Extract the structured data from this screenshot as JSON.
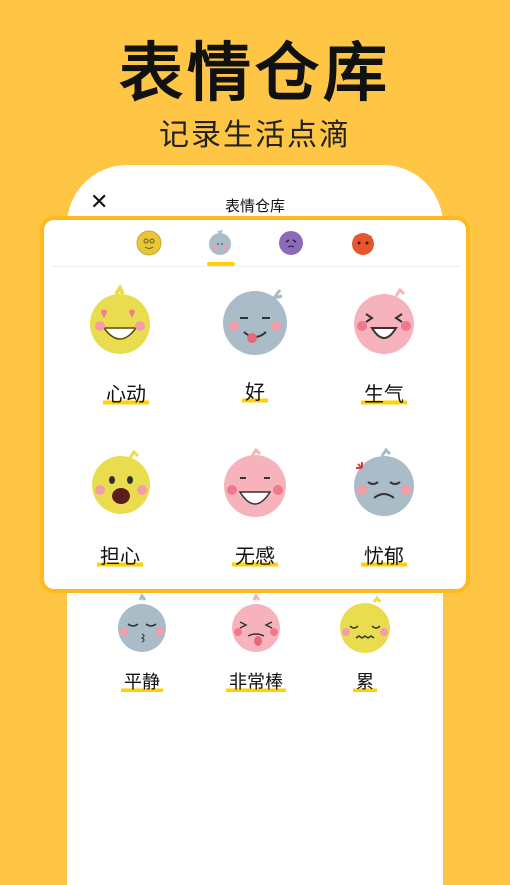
{
  "promo": {
    "title": "表情仓库",
    "subtitle": "记录生活点滴"
  },
  "dialog": {
    "title": "表情仓库",
    "close_label": "✕"
  },
  "tabs": [
    {
      "name": "happy-face-tab",
      "color": "#E8C63A"
    },
    {
      "name": "blue-face-tab",
      "color": "#A9BCC8",
      "selected": true
    },
    {
      "name": "purple-face-tab",
      "color": "#8C6AB5"
    },
    {
      "name": "devil-face-tab",
      "color": "#E4572E"
    }
  ],
  "moods": [
    {
      "label": "心动",
      "color": "#E9DD4F",
      "face": "heart-eyes"
    },
    {
      "label": "好",
      "color": "#A9BCC8",
      "face": "tongue"
    },
    {
      "label": "生气",
      "color": "#F7B3BC",
      "face": "laugh"
    },
    {
      "label": "担心",
      "color": "#E9DD4F",
      "face": "worried"
    },
    {
      "label": "无感",
      "color": "#F7B3BC",
      "face": "blank-smile"
    },
    {
      "label": "忧郁",
      "color": "#A9BCC8",
      "face": "gloomy"
    },
    {
      "label": "平静",
      "color": "#A9BCC8",
      "face": "calm"
    },
    {
      "label": "非常棒",
      "color": "#F7B3BC",
      "face": "great"
    },
    {
      "label": "累",
      "color": "#E9DD4F",
      "face": "tired"
    }
  ]
}
